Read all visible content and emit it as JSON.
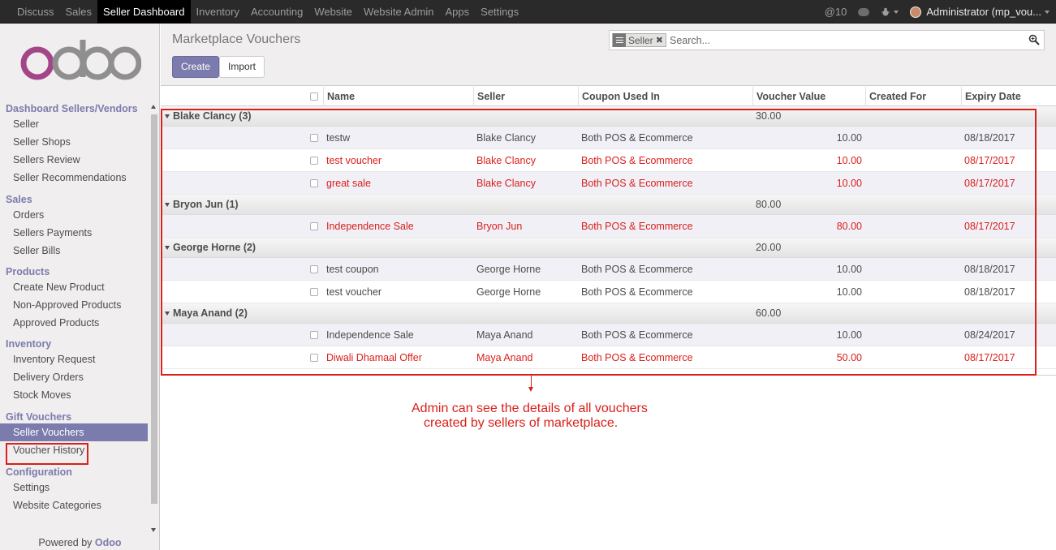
{
  "topbar": {
    "menus": [
      "Discuss",
      "Sales",
      "Seller Dashboard",
      "Inventory",
      "Accounting",
      "Website",
      "Website Admin",
      "Apps",
      "Settings"
    ],
    "active_menu": "Seller Dashboard",
    "mentions": "@10",
    "user": "Administrator (mp_vou..."
  },
  "sidebar": {
    "logo_text": "odoo",
    "sections": [
      {
        "title": "Dashboard Sellers/Vendors",
        "items": [
          "Seller",
          "Seller Shops",
          "Sellers Review",
          "Seller Recommendations"
        ]
      },
      {
        "title": "Sales",
        "items": [
          "Orders",
          "Sellers Payments",
          "Seller Bills"
        ]
      },
      {
        "title": "Products",
        "items": [
          "Create New Product",
          "Non-Approved Products",
          "Approved Products"
        ]
      },
      {
        "title": "Inventory",
        "items": [
          "Inventory Request",
          "Delivery Orders",
          "Stock Moves"
        ]
      },
      {
        "title": "Gift Vouchers",
        "items": [
          "Seller Vouchers",
          "Voucher History"
        ]
      },
      {
        "title": "Configuration",
        "items": [
          "Settings",
          "Website Categories"
        ]
      }
    ],
    "active_item": "Seller Vouchers",
    "powered_by": "Powered by",
    "powered_brand": "Odoo"
  },
  "control": {
    "title": "Marketplace Vouchers",
    "create_label": "Create",
    "import_label": "Import",
    "facet_label": "Seller",
    "search_placeholder": "Search..."
  },
  "table": {
    "columns": [
      "Name",
      "Seller",
      "Coupon Used In",
      "Voucher Value",
      "Created For",
      "Expiry Date"
    ],
    "groups": [
      {
        "label": "Blake Clancy (3)",
        "total": "30.00",
        "rows": [
          {
            "name": "testw",
            "seller": "Blake Clancy",
            "coupon": "Both POS & Ecommerce",
            "value": "10.00",
            "created_for": "",
            "expiry": "08/18/2017",
            "expired": false
          },
          {
            "name": "test voucher",
            "seller": "Blake Clancy",
            "coupon": "Both POS & Ecommerce",
            "value": "10.00",
            "created_for": "",
            "expiry": "08/17/2017",
            "expired": true
          },
          {
            "name": "great sale",
            "seller": "Blake Clancy",
            "coupon": "Both POS & Ecommerce",
            "value": "10.00",
            "created_for": "",
            "expiry": "08/17/2017",
            "expired": true
          }
        ]
      },
      {
        "label": "Bryon Jun (1)",
        "total": "80.00",
        "rows": [
          {
            "name": "Independence Sale",
            "seller": "Bryon Jun",
            "coupon": "Both POS & Ecommerce",
            "value": "80.00",
            "created_for": "",
            "expiry": "08/17/2017",
            "expired": true
          }
        ]
      },
      {
        "label": "George Horne (2)",
        "total": "20.00",
        "rows": [
          {
            "name": "test coupon",
            "seller": "George Horne",
            "coupon": "Both POS & Ecommerce",
            "value": "10.00",
            "created_for": "",
            "expiry": "08/18/2017",
            "expired": false
          },
          {
            "name": "test voucher",
            "seller": "George Horne",
            "coupon": "Both POS & Ecommerce",
            "value": "10.00",
            "created_for": "",
            "expiry": "08/18/2017",
            "expired": false
          }
        ]
      },
      {
        "label": "Maya Anand (2)",
        "total": "60.00",
        "rows": [
          {
            "name": "Independence Sale",
            "seller": "Maya Anand",
            "coupon": "Both POS & Ecommerce",
            "value": "10.00",
            "created_for": "",
            "expiry": "08/24/2017",
            "expired": false
          },
          {
            "name": "Diwali Dhamaal Offer",
            "seller": "Maya Anand",
            "coupon": "Both POS & Ecommerce",
            "value": "50.00",
            "created_for": "",
            "expiry": "08/17/2017",
            "expired": true
          }
        ]
      }
    ]
  },
  "annotation": {
    "line1": "Admin can see the details of all vouchers",
    "line2": "created by sellers of marketplace.",
    "color": "#d9201b"
  },
  "colors": {
    "brand": "#7c7bad",
    "warning": "#d9201b",
    "navbar": "#2a2a2a"
  }
}
